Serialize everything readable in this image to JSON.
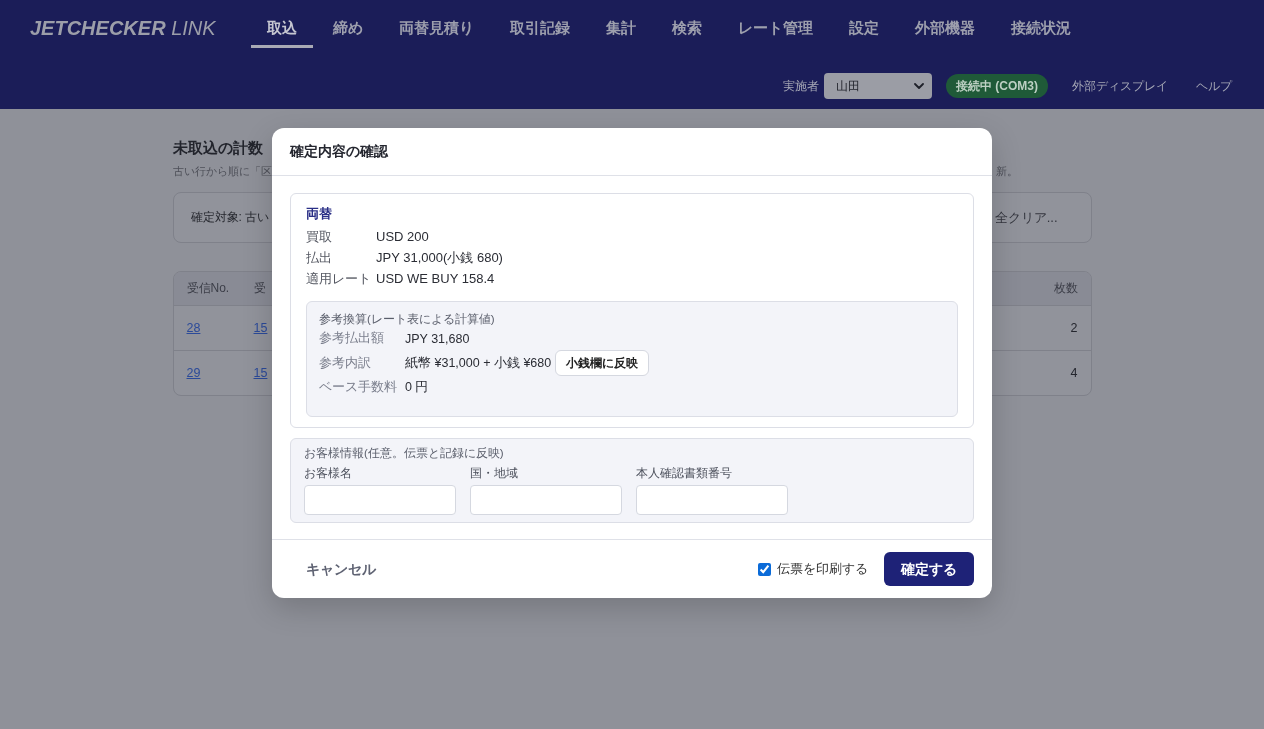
{
  "header": {
    "logo": "**JETCHECKER** LINK",
    "nav": [
      {
        "label": "取込",
        "selected": true
      },
      {
        "label": "締め",
        "selected": false
      },
      {
        "label": "両替見積り",
        "selected": false
      },
      {
        "label": "取引記録",
        "selected": false
      },
      {
        "label": "集計",
        "selected": false
      },
      {
        "label": "検索",
        "selected": false
      },
      {
        "label": "レート管理",
        "selected": false
      },
      {
        "label": "設定",
        "selected": false
      },
      {
        "label": "外部機器",
        "selected": false
      },
      {
        "label": "接続状況",
        "selected": false
      }
    ],
    "operator": {
      "label": "実施者",
      "value": "山田"
    },
    "connection": {
      "label": "接続中 (COM3)",
      "connected": true
    },
    "links": [
      "外部ディスプレイ",
      "ヘルプ"
    ]
  },
  "page": {
    "title": "未取込の計数",
    "subtitle_left": "古い行から順に「区",
    "subtitle_right": "新。",
    "target_card": {
      "text": "確定対象: 古い",
      "button": "全クリア..."
    },
    "table": {
      "columns": [
        "受信No.",
        "受",
        "枚数"
      ],
      "rows": [
        {
          "cells": [
            "28",
            "15",
            "2"
          ]
        },
        {
          "cells": [
            "29",
            "15",
            "4"
          ]
        }
      ]
    }
  },
  "dialog": {
    "title": "確定内容の確認",
    "exchange": {
      "heading": "両替",
      "rows": [
        {
          "label": "買取",
          "value": "USD 200"
        },
        {
          "label": "払出",
          "value": "JPY 31,000(小銭 680)"
        },
        {
          "label": "適用レート",
          "value": "USD WE BUY 158.4"
        }
      ],
      "reference": {
        "title": "参考換算(レート表による計算値)",
        "rows": [
          {
            "label": "参考払出額",
            "value": "JPY 31,680"
          },
          {
            "label": "参考内訳",
            "value": "紙幣 ¥31,000 + 小銭 ¥680",
            "button": "小銭欄に反映"
          },
          {
            "label": "ベース手数料",
            "value": "0 円"
          }
        ]
      }
    },
    "customer": {
      "title": "お客様情報(任意。伝票と記録に反映)",
      "fields": [
        {
          "label": "お客様名"
        },
        {
          "label": "国・地域"
        },
        {
          "label": "本人確認書類番号"
        }
      ]
    },
    "footer": {
      "cancel": "キャンセル",
      "print_slip": {
        "label": "伝票を印刷する",
        "checked": true
      },
      "confirm": "確定する"
    }
  }
}
